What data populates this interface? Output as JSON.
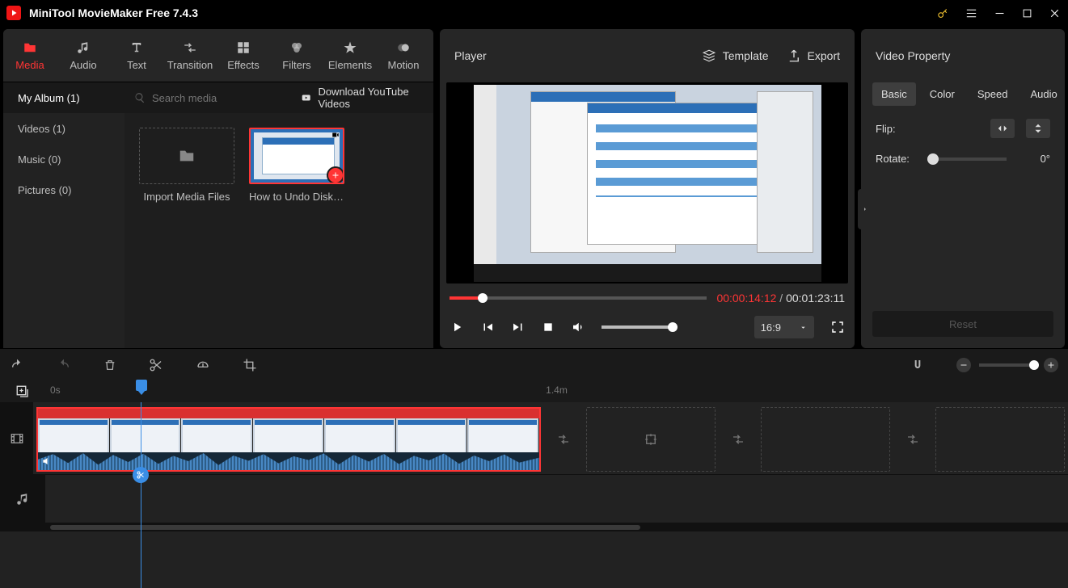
{
  "app": {
    "title": "MiniTool MovieMaker Free 7.4.3"
  },
  "mediaTabs": [
    "Media",
    "Audio",
    "Text",
    "Transition",
    "Effects",
    "Filters",
    "Elements",
    "Motion"
  ],
  "album": {
    "items": [
      "My Album (1)",
      "Videos (1)",
      "Music (0)",
      "Pictures (0)"
    ],
    "searchPlaceholder": "Search media",
    "downloadYT": "Download YouTube Videos",
    "importLabel": "Import Media Files",
    "clipLabel": "How to Undo Diskp..."
  },
  "player": {
    "title": "Player",
    "template": "Template",
    "export": "Export",
    "current": "00:00:14:12",
    "total": "00:01:23:11",
    "aspect": "16:9"
  },
  "props": {
    "title": "Video Property",
    "tabs": [
      "Basic",
      "Color",
      "Speed",
      "Audio"
    ],
    "flip": "Flip:",
    "rotate": "Rotate:",
    "rotateVal": "0°",
    "reset": "Reset"
  },
  "timeline": {
    "zero": "0s",
    "mid": "1.4m"
  }
}
